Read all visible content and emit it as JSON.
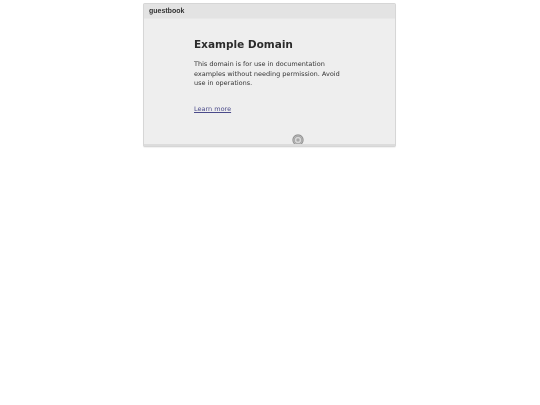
{
  "window": {
    "title": "guestbook"
  },
  "page": {
    "heading": "Example Domain",
    "body": "This domain is for use in documentation examples without needing permission. Avoid use in operations.",
    "link_text": "Learn more"
  },
  "icons": {
    "loader": "gear-spinner-icon"
  }
}
